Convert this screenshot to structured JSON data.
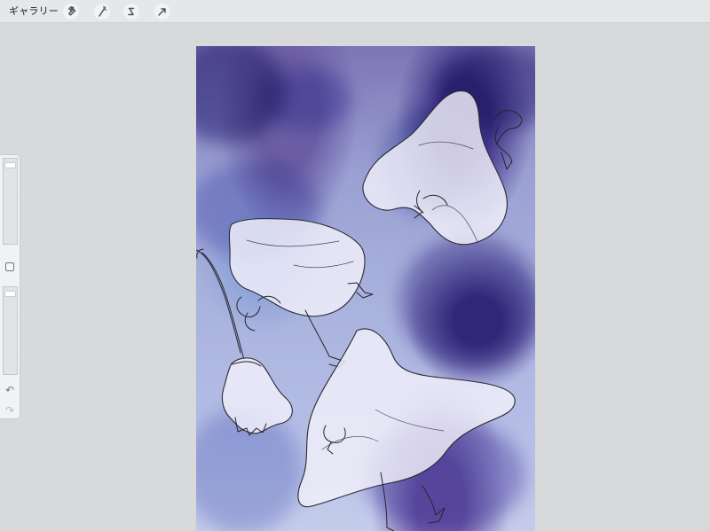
{
  "app": {
    "gallery_label": "ギャラリー"
  },
  "toolbar": {
    "left_icons": [
      "wrench-icon",
      "magic-wand-icon",
      "selection-icon",
      "transform-arrow-icon"
    ],
    "right_icons": [
      "brush-icon",
      "smudge-icon",
      "eraser-icon",
      "layers-icon",
      "color-picker"
    ]
  },
  "colors": {
    "accent_brush": "#2f78d8",
    "current_color": "#29272f",
    "toolbar_bg": "#e6e7e8",
    "workspace_bg": "#d8d9db"
  },
  "sidebar": {
    "brush_size": 0.94,
    "opacity": 0.94,
    "icons": [
      "brush-size-slider",
      "modify-button",
      "opacity-slider",
      "undo-icon",
      "redo-icon"
    ]
  },
  "canvas": {
    "artwork_description_visible": false
  }
}
